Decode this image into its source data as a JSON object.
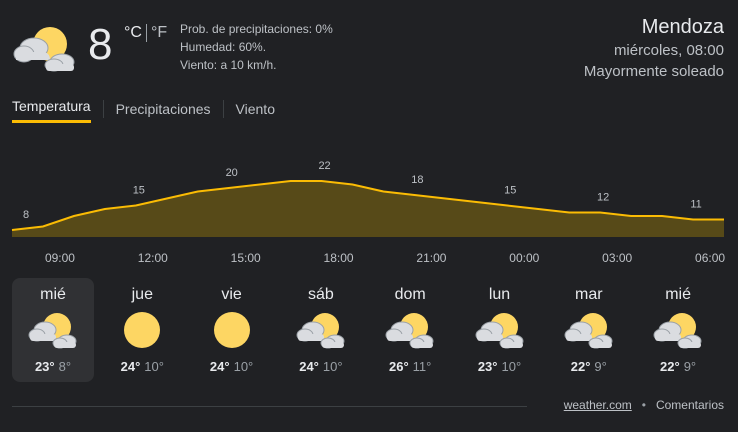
{
  "current": {
    "temp": "8",
    "unit_c": "°C",
    "unit_f": "°F",
    "icon": "partly-sunny-icon",
    "precip": "Prob. de precipitaciones: 0%",
    "humidity": "Humedad: 60%.",
    "wind": "Viento: a 10 km/h."
  },
  "location": {
    "city": "Mendoza",
    "datetime": "miércoles, 08:00",
    "condition": "Mayormente soleado"
  },
  "tabs": [
    {
      "label": "Temperatura",
      "active": true
    },
    {
      "label": "Precipitaciones",
      "active": false
    },
    {
      "label": "Viento",
      "active": false
    }
  ],
  "chart_data": {
    "type": "area",
    "x_labels": [
      "09:00",
      "12:00",
      "15:00",
      "18:00",
      "21:00",
      "00:00",
      "03:00",
      "06:00"
    ],
    "x": [
      "08:00",
      "09:00",
      "10:00",
      "11:00",
      "12:00",
      "13:00",
      "14:00",
      "15:00",
      "16:00",
      "17:00",
      "18:00",
      "19:00",
      "20:00",
      "21:00",
      "22:00",
      "23:00",
      "00:00",
      "01:00",
      "02:00",
      "03:00",
      "04:00",
      "05:00",
      "06:00",
      "07:00"
    ],
    "values": [
      8,
      9,
      12,
      14,
      15,
      17,
      19,
      20,
      21,
      22,
      22,
      21,
      19,
      18,
      17,
      16,
      15,
      14,
      13,
      13,
      12,
      12,
      11,
      11
    ],
    "data_labels": [
      {
        "index": 0,
        "text": "8"
      },
      {
        "index": 4,
        "text": "15"
      },
      {
        "index": 7,
        "text": "20"
      },
      {
        "index": 10,
        "text": "22"
      },
      {
        "index": 13,
        "text": "18"
      },
      {
        "index": 16,
        "text": "15"
      },
      {
        "index": 19,
        "text": "12"
      },
      {
        "index": 22,
        "text": "11"
      }
    ],
    "line_color": "#fbbc04",
    "fill_color": "#574a18"
  },
  "days": [
    {
      "name": "mié",
      "hi": "23°",
      "lo": "8°",
      "icon": "partly-sunny-icon",
      "selected": true
    },
    {
      "name": "jue",
      "hi": "24°",
      "lo": "10°",
      "icon": "sunny-icon",
      "selected": false
    },
    {
      "name": "vie",
      "hi": "24°",
      "lo": "10°",
      "icon": "sunny-icon",
      "selected": false
    },
    {
      "name": "sáb",
      "hi": "24°",
      "lo": "10°",
      "icon": "partly-sunny-icon",
      "selected": false
    },
    {
      "name": "dom",
      "hi": "26°",
      "lo": "11°",
      "icon": "partly-sunny-icon",
      "selected": false
    },
    {
      "name": "lun",
      "hi": "23°",
      "lo": "10°",
      "icon": "partly-sunny-icon",
      "selected": false
    },
    {
      "name": "mar",
      "hi": "22°",
      "lo": "9°",
      "icon": "partly-sunny-icon",
      "selected": false
    },
    {
      "name": "mié",
      "hi": "22°",
      "lo": "9°",
      "icon": "partly-sunny-icon",
      "selected": false
    }
  ],
  "footer": {
    "source": "weather.com",
    "dot": "•",
    "feedback": "Comentarios"
  }
}
